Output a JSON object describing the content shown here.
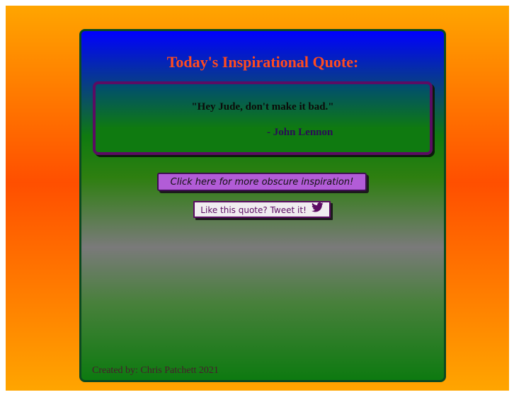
{
  "header": {
    "title": "Today's Inspirational Quote:"
  },
  "quote": {
    "text": "\"Hey Jude, don't make it bad.\"",
    "author": "- John Lennon"
  },
  "buttons": {
    "more_label": "Click here for more obscure inspiration!",
    "tweet_label": "Like this quote? Tweet it!"
  },
  "footer": {
    "credit": "Created by: Chris Patchett 2021"
  },
  "icons": {
    "tweet_icon": "twitter-icon"
  },
  "colors": {
    "title": "#ff4b1f",
    "background_orange": "#ffa500",
    "background_red": "#ff4f00",
    "button_purple": "#b25cd7",
    "border_purple": "#5b0c63"
  }
}
